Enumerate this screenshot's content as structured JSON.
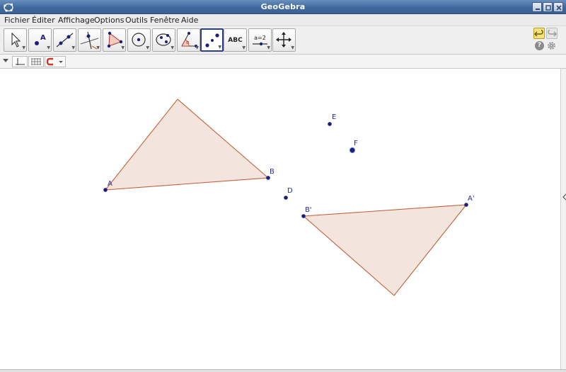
{
  "window": {
    "title": "GeoGebra"
  },
  "menu": {
    "items": [
      "Fichier",
      "Éditer",
      "Affichage",
      "Options",
      "Outils",
      "Fenêtre",
      "Aide"
    ]
  },
  "toolbar": {
    "tools": [
      {
        "name": "move-tool",
        "icon": "arrow-cursor-icon"
      },
      {
        "name": "point-tool",
        "icon": "point-a-icon"
      },
      {
        "name": "line-tool",
        "icon": "line-through-points-icon"
      },
      {
        "name": "perpendicular-tool",
        "icon": "perpendicular-line-icon"
      },
      {
        "name": "polygon-tool",
        "icon": "polygon-icon"
      },
      {
        "name": "circle-tool",
        "icon": "circle-center-point-icon"
      },
      {
        "name": "conic-tool",
        "icon": "ellipse-icon"
      },
      {
        "name": "angle-tool",
        "icon": "angle-icon"
      },
      {
        "name": "reflect-tool",
        "icon": "reflect-about-point-icon"
      },
      {
        "name": "text-tool",
        "icon": "text-icon",
        "label": "ABC"
      },
      {
        "name": "slider-tool",
        "icon": "slider-icon",
        "label": "a=2"
      },
      {
        "name": "move-graphics-tool",
        "icon": "move-view-icon"
      }
    ],
    "selected_index": 8
  },
  "graphics": {
    "fill_color": "#f3e4dd",
    "stroke_color": "#c1613a",
    "point_color": "#1a1f7a",
    "points": [
      {
        "label": "A"
      },
      {
        "label": "B"
      },
      {
        "label": "D"
      },
      {
        "label": "E"
      },
      {
        "label": "F"
      },
      {
        "label": "A'"
      },
      {
        "label": "B'"
      }
    ]
  }
}
